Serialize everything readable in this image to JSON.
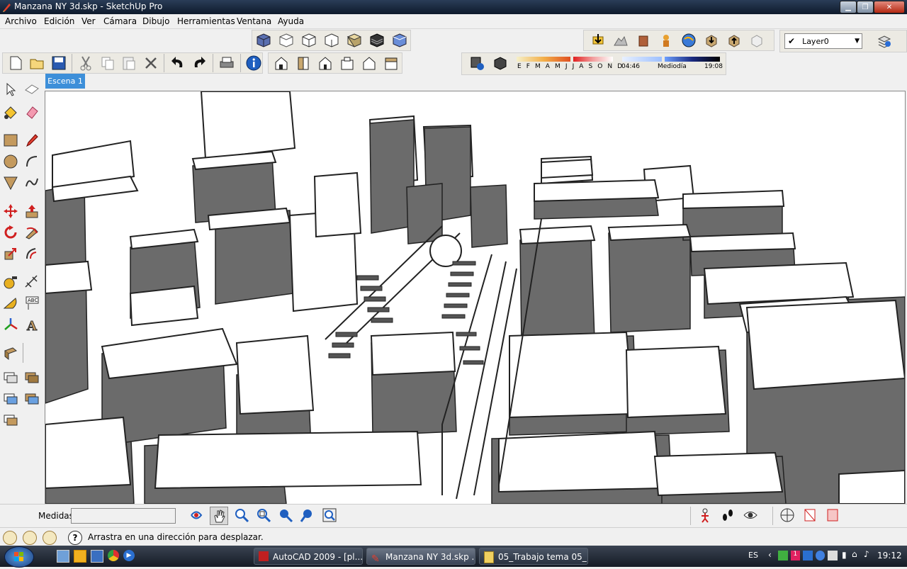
{
  "window": {
    "title": "Manzana NY 3d.skp - SketchUp Pro",
    "app_icon": "sketchup-icon"
  },
  "menu": [
    "Archivo",
    "Edición",
    "Ver",
    "Cámara",
    "Dibujo",
    "Herramientas",
    "Ventana",
    "Ayuda"
  ],
  "layers": {
    "current": "Layer0"
  },
  "shadows": {
    "months": "E F M A M J J A S O N D",
    "time_start": "04:46",
    "time_mid": "Mediodía",
    "time_end": "19:08"
  },
  "scene": {
    "tab_label": "Escena 1"
  },
  "measurements": {
    "label": "Medidas",
    "value": ""
  },
  "status": {
    "hint": "Arrastra en una dirección para desplazar."
  },
  "taskbar": {
    "tasks": [
      "AutoCAD 2009 - [pl...",
      "Manzana NY 3d.skp ...",
      "05_Trabajo tema 05_..."
    ],
    "language": "ES",
    "clock": "19:12"
  },
  "colors": {
    "accent": "#3d8fd9",
    "shadow": "#6e6e6e",
    "building": "#ffffff"
  }
}
